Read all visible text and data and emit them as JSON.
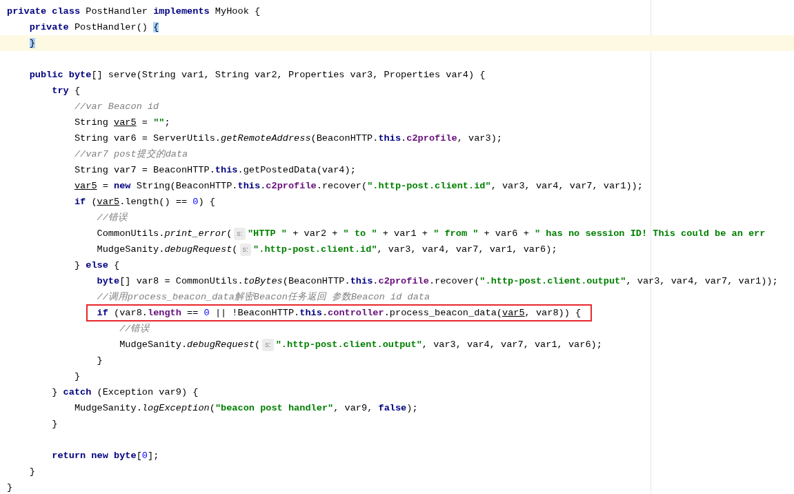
{
  "editor": {
    "lines": [
      {
        "kind": "code",
        "tokens": [
          {
            "kind": "keyword",
            "text": "private class"
          },
          {
            "kind": "plain",
            "text": " PostHandler "
          },
          {
            "kind": "keyword",
            "text": "implements"
          },
          {
            "kind": "plain",
            "text": " MyHook {"
          }
        ]
      },
      {
        "kind": "code",
        "tokens": [
          {
            "kind": "keyword",
            "text": "    private"
          },
          {
            "kind": "plain",
            "text": " PostHandler() "
          },
          {
            "kind": "brace",
            "text": "{"
          }
        ]
      },
      {
        "kind": "code",
        "highlighted": true,
        "tokens": [
          {
            "kind": "brace",
            "text": "    }"
          }
        ]
      },
      {
        "kind": "blank"
      },
      {
        "kind": "code",
        "tokens": [
          {
            "kind": "keyword",
            "text": "    public byte"
          },
          {
            "kind": "plain",
            "text": "[] serve(String var1, String var2, Properties var3, Properties var4) {"
          }
        ]
      },
      {
        "kind": "code",
        "tokens": [
          {
            "kind": "keyword",
            "text": "        try"
          },
          {
            "kind": "plain",
            "text": " {"
          }
        ]
      },
      {
        "kind": "code",
        "tokens": [
          {
            "kind": "comment",
            "text": "            //var Beacon id"
          }
        ]
      },
      {
        "kind": "code",
        "tokens": [
          {
            "kind": "plain",
            "text": "            String "
          },
          {
            "kind": "underlined",
            "text": "var5"
          },
          {
            "kind": "plain",
            "text": " = "
          },
          {
            "kind": "string",
            "text": "\"\""
          },
          {
            "kind": "plain",
            "text": ";"
          }
        ]
      },
      {
        "kind": "code",
        "tokens": [
          {
            "kind": "plain",
            "text": "            String var6 = ServerUtils."
          },
          {
            "kind": "static",
            "text": "getRemoteAddress"
          },
          {
            "kind": "plain",
            "text": "(BeaconHTTP."
          },
          {
            "kind": "keyword",
            "text": "this"
          },
          {
            "kind": "plain",
            "text": "."
          },
          {
            "kind": "field",
            "text": "c2profile"
          },
          {
            "kind": "plain",
            "text": ", var3);"
          }
        ]
      },
      {
        "kind": "code",
        "tokens": [
          {
            "kind": "comment",
            "text": "            //var7 post提交的data"
          }
        ]
      },
      {
        "kind": "code",
        "tokens": [
          {
            "kind": "plain",
            "text": "            String var7 = BeaconHTTP."
          },
          {
            "kind": "keyword",
            "text": "this"
          },
          {
            "kind": "plain",
            "text": ".getPostedData(var4);"
          }
        ]
      },
      {
        "kind": "code",
        "tokens": [
          {
            "kind": "underlined",
            "text": "            var5"
          },
          {
            "kind": "plain",
            "text": " = "
          },
          {
            "kind": "keyword",
            "text": "new"
          },
          {
            "kind": "plain",
            "text": " String(BeaconHTTP."
          },
          {
            "kind": "keyword",
            "text": "this"
          },
          {
            "kind": "plain",
            "text": "."
          },
          {
            "kind": "field",
            "text": "c2profile"
          },
          {
            "kind": "plain",
            "text": ".recover("
          },
          {
            "kind": "string",
            "text": "\".http-post.client.id\""
          },
          {
            "kind": "plain",
            "text": ", var3, var4, var7, var1));"
          }
        ]
      },
      {
        "kind": "code",
        "tokens": [
          {
            "kind": "keyword",
            "text": "            if"
          },
          {
            "kind": "plain",
            "text": " ("
          },
          {
            "kind": "underlined",
            "text": "var5"
          },
          {
            "kind": "plain",
            "text": ".length() == "
          },
          {
            "kind": "number",
            "text": "0"
          },
          {
            "kind": "plain",
            "text": ") {"
          }
        ]
      },
      {
        "kind": "code",
        "tokens": [
          {
            "kind": "comment",
            "text": "                //错误"
          }
        ]
      },
      {
        "kind": "code",
        "tokens": [
          {
            "kind": "plain",
            "text": "                CommonUtils."
          },
          {
            "kind": "static",
            "text": "print_error"
          },
          {
            "kind": "plain",
            "text": "("
          },
          {
            "kind": "hint",
            "text": "s:"
          },
          {
            "kind": "string",
            "text": "\"HTTP \""
          },
          {
            "kind": "plain",
            "text": " + var2 + "
          },
          {
            "kind": "string",
            "text": "\" to \""
          },
          {
            "kind": "plain",
            "text": " + var1 + "
          },
          {
            "kind": "string",
            "text": "\" from \""
          },
          {
            "kind": "plain",
            "text": " + var6 + "
          },
          {
            "kind": "string",
            "text": "\" has no session ID! This could be an err"
          }
        ]
      },
      {
        "kind": "code",
        "tokens": [
          {
            "kind": "plain",
            "text": "                MudgeSanity."
          },
          {
            "kind": "static",
            "text": "debugRequest"
          },
          {
            "kind": "plain",
            "text": "("
          },
          {
            "kind": "hint",
            "text": "s:"
          },
          {
            "kind": "string",
            "text": "\".http-post.client.id\""
          },
          {
            "kind": "plain",
            "text": ", var3, var4, var7, var1, var6);"
          }
        ]
      },
      {
        "kind": "code",
        "tokens": [
          {
            "kind": "plain",
            "text": "            } "
          },
          {
            "kind": "keyword",
            "text": "else"
          },
          {
            "kind": "plain",
            "text": " {"
          }
        ]
      },
      {
        "kind": "code",
        "tokens": [
          {
            "kind": "keyword",
            "text": "                byte"
          },
          {
            "kind": "plain",
            "text": "[] var8 = CommonUtils."
          },
          {
            "kind": "static",
            "text": "toBytes"
          },
          {
            "kind": "plain",
            "text": "(BeaconHTTP."
          },
          {
            "kind": "keyword",
            "text": "this"
          },
          {
            "kind": "plain",
            "text": "."
          },
          {
            "kind": "field",
            "text": "c2profile"
          },
          {
            "kind": "plain",
            "text": ".recover("
          },
          {
            "kind": "string",
            "text": "\".http-post.client.output\""
          },
          {
            "kind": "plain",
            "text": ", var3, var4, var7, var1));"
          }
        ]
      },
      {
        "kind": "code",
        "tokens": [
          {
            "kind": "comment",
            "text": "                //调用process_beacon_data解密Beacon任务返回 参数Beacon id data"
          }
        ]
      },
      {
        "kind": "code",
        "boxed": true,
        "tokens": [
          {
            "kind": "keyword",
            "text": "                if"
          },
          {
            "kind": "plain",
            "text": " (var8."
          },
          {
            "kind": "field",
            "text": "length"
          },
          {
            "kind": "plain",
            "text": " == "
          },
          {
            "kind": "number",
            "text": "0"
          },
          {
            "kind": "plain",
            "text": " || !BeaconHTTP."
          },
          {
            "kind": "keyword",
            "text": "this"
          },
          {
            "kind": "plain",
            "text": "."
          },
          {
            "kind": "field",
            "text": "controller"
          },
          {
            "kind": "plain",
            "text": ".process_beacon_data("
          },
          {
            "kind": "underlined",
            "text": "var5"
          },
          {
            "kind": "plain",
            "text": ", var8)) {"
          }
        ]
      },
      {
        "kind": "code",
        "tokens": [
          {
            "kind": "comment",
            "text": "                    //错误"
          }
        ]
      },
      {
        "kind": "code",
        "tokens": [
          {
            "kind": "plain",
            "text": "                    MudgeSanity."
          },
          {
            "kind": "static",
            "text": "debugRequest"
          },
          {
            "kind": "plain",
            "text": "("
          },
          {
            "kind": "hint",
            "text": "s:"
          },
          {
            "kind": "string",
            "text": "\".http-post.client.output\""
          },
          {
            "kind": "plain",
            "text": ", var3, var4, var7, var1, var6);"
          }
        ]
      },
      {
        "kind": "code",
        "tokens": [
          {
            "kind": "plain",
            "text": "                }"
          }
        ]
      },
      {
        "kind": "code",
        "tokens": [
          {
            "kind": "plain",
            "text": "            }"
          }
        ]
      },
      {
        "kind": "code",
        "tokens": [
          {
            "kind": "plain",
            "text": "        } "
          },
          {
            "kind": "keyword",
            "text": "catch"
          },
          {
            "kind": "plain",
            "text": " (Exception var9) {"
          }
        ]
      },
      {
        "kind": "code",
        "tokens": [
          {
            "kind": "plain",
            "text": "            MudgeSanity."
          },
          {
            "kind": "static",
            "text": "logException"
          },
          {
            "kind": "plain",
            "text": "("
          },
          {
            "kind": "string",
            "text": "\"beacon post handler\""
          },
          {
            "kind": "plain",
            "text": ", var9, "
          },
          {
            "kind": "keyword",
            "text": "false"
          },
          {
            "kind": "plain",
            "text": ");"
          }
        ]
      },
      {
        "kind": "code",
        "tokens": [
          {
            "kind": "plain",
            "text": "        }"
          }
        ]
      },
      {
        "kind": "blank"
      },
      {
        "kind": "code",
        "tokens": [
          {
            "kind": "keyword",
            "text": "        return new byte"
          },
          {
            "kind": "plain",
            "text": "["
          },
          {
            "kind": "number",
            "text": "0"
          },
          {
            "kind": "plain",
            "text": "];"
          }
        ]
      },
      {
        "kind": "code",
        "tokens": [
          {
            "kind": "plain",
            "text": "    }"
          }
        ]
      },
      {
        "kind": "code",
        "tokens": [
          {
            "kind": "plain",
            "text": "}"
          }
        ]
      }
    ]
  }
}
